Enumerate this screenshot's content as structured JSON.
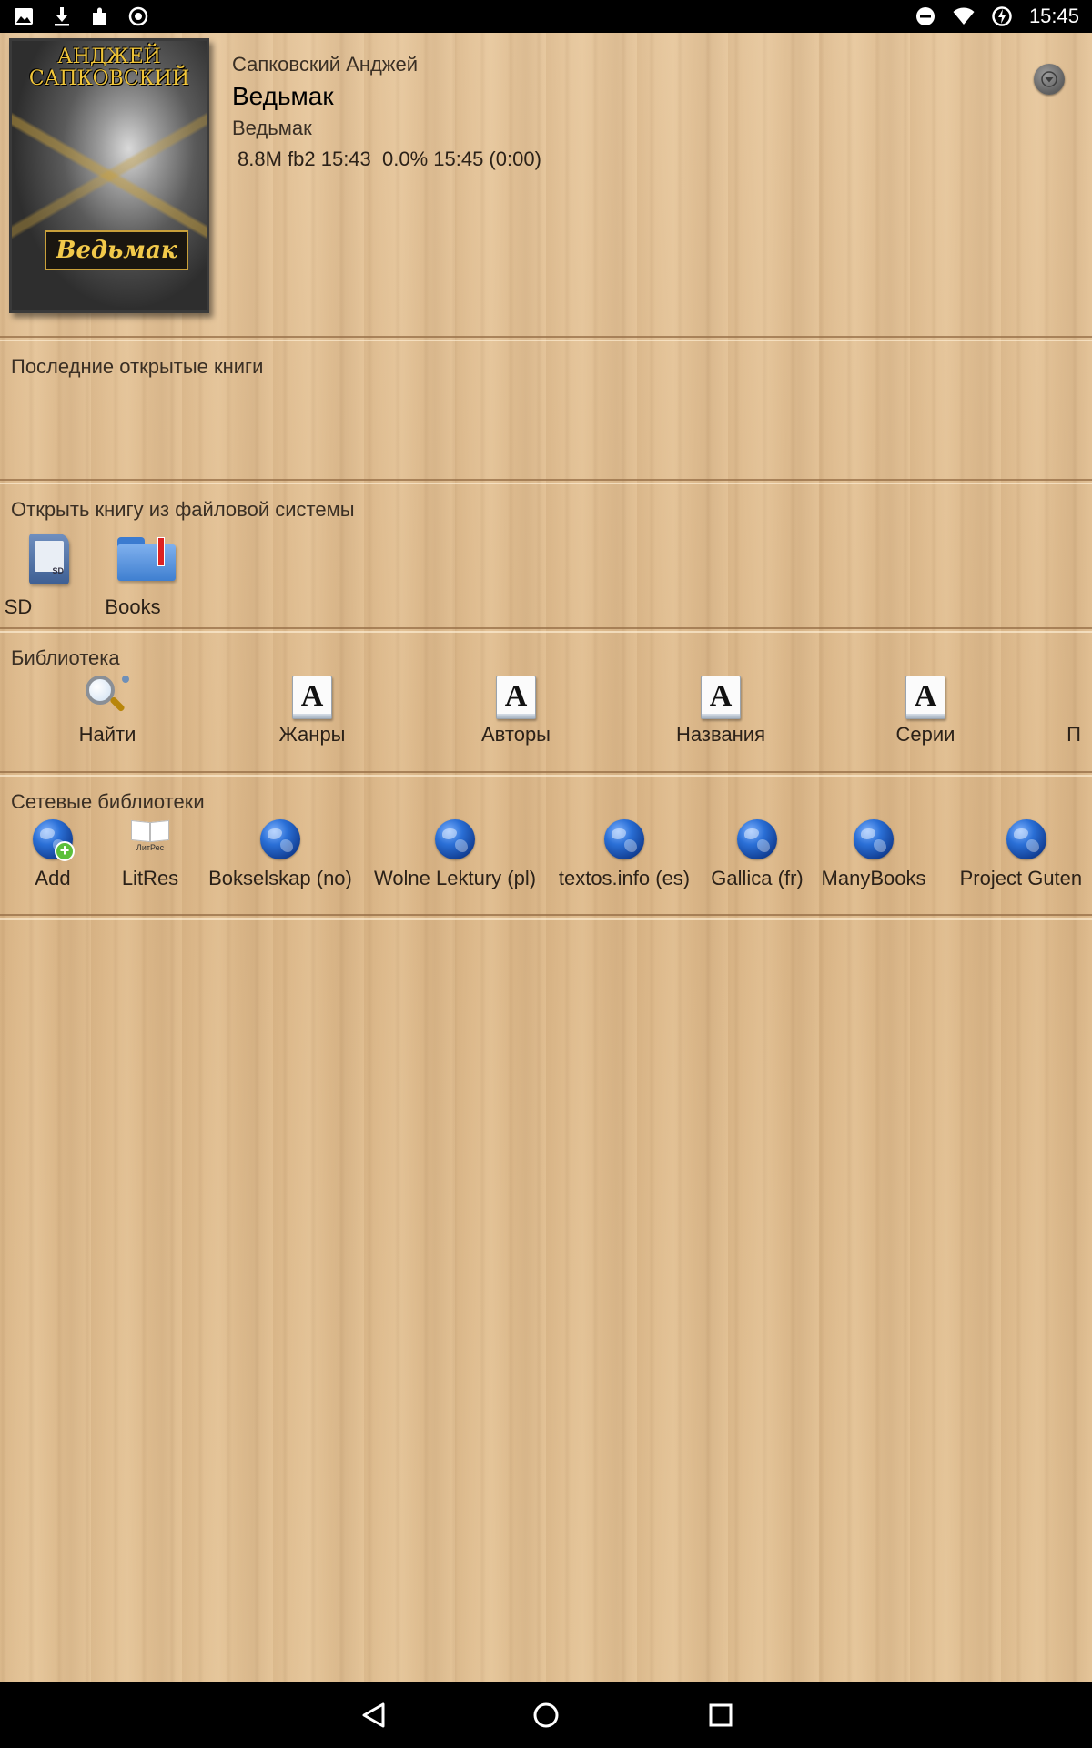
{
  "status_bar": {
    "time": "15:45",
    "left_icons": [
      "image-icon",
      "download-icon",
      "puzzle-icon",
      "record-icon"
    ],
    "right_icons": [
      "do-not-disturb-icon",
      "wifi-icon",
      "data-saver-icon"
    ]
  },
  "current_book": {
    "author": "Сапковский Анджей",
    "title": "Ведьмак",
    "series": "Ведьмак",
    "info": "8.8M fb2 15:43  0.0% 15:45 (0:00)",
    "cover": {
      "author_line1": "АНДЖЕЙ",
      "author_line2": "САПКОВСКИЙ",
      "title": "Ведьмак"
    }
  },
  "sections": {
    "recent": {
      "title": "Последние открытые книги"
    },
    "filesystem": {
      "title": "Открыть книгу из файловой системы",
      "items": [
        {
          "label": "SD",
          "icon": "sd-card-icon"
        },
        {
          "label": "Books",
          "icon": "folder-icon"
        }
      ]
    },
    "library": {
      "title": "Библиотека",
      "items": [
        {
          "label": "Найти",
          "icon": "search-icon"
        },
        {
          "label": "Жанры",
          "icon": "document-icon"
        },
        {
          "label": "Авторы",
          "icon": "document-icon"
        },
        {
          "label": "Названия",
          "icon": "document-icon"
        },
        {
          "label": "Серии",
          "icon": "document-icon"
        },
        {
          "label": "П",
          "icon": "document-icon"
        }
      ]
    },
    "network": {
      "title": "Сетевые библиотеки",
      "items": [
        {
          "label": "Add",
          "icon": "globe-add-icon"
        },
        {
          "label": "LitRes",
          "icon": "litres-icon",
          "brand": "ЛитРес"
        },
        {
          "label": "Bokselskap (no)",
          "icon": "globe-icon"
        },
        {
          "label": "Wolne Lektury (pl)",
          "icon": "globe-icon"
        },
        {
          "label": "textos.info (es)",
          "icon": "globe-icon"
        },
        {
          "label": "Gallica (fr)",
          "icon": "globe-icon"
        },
        {
          "label": "ManyBooks",
          "icon": "globe-icon"
        },
        {
          "label": "Project Gutenb",
          "icon": "globe-icon"
        }
      ]
    }
  },
  "nav_bar": {
    "buttons": [
      "back-icon",
      "home-icon",
      "recents-icon"
    ]
  }
}
